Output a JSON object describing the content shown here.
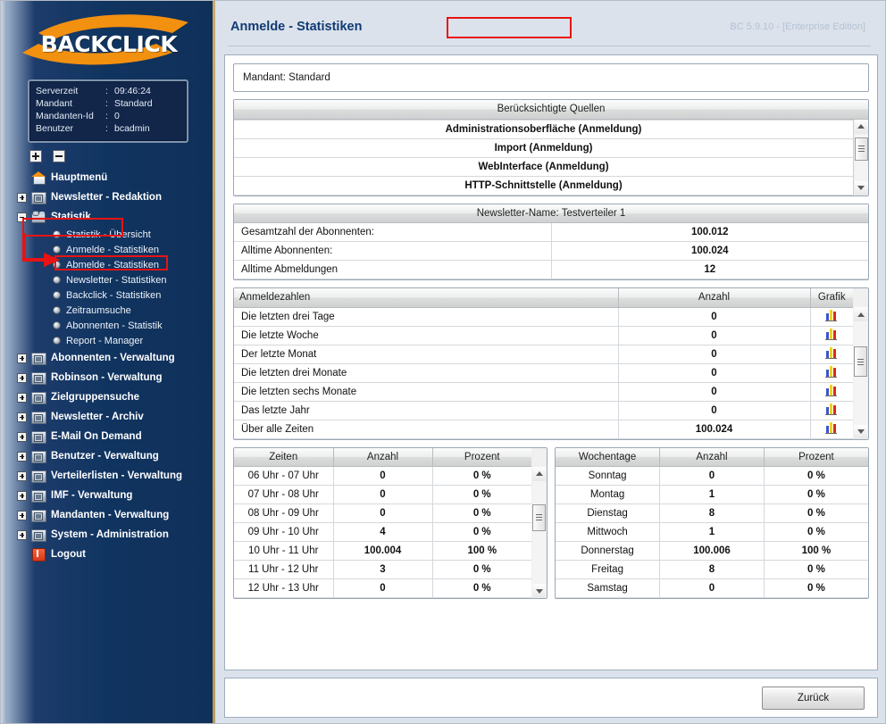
{
  "app": {
    "logo_text": "BACKCLICK",
    "version": "BC 5.9.10 - [Enterprise Edition]"
  },
  "sidebar": {
    "info": {
      "rows": [
        {
          "key": "Serverzeit",
          "sep": ":",
          "value": "09:46:24"
        },
        {
          "key": "Mandant",
          "sep": ":",
          "value": "Standard"
        },
        {
          "key": "Mandanten-Id",
          "sep": ":",
          "value": "0"
        },
        {
          "key": "Benutzer",
          "sep": ":",
          "value": "bcadmin"
        }
      ]
    },
    "expand_all_label": "+",
    "collapse_all_label": "-",
    "items": [
      {
        "label": "Hauptmenü",
        "icon": "house",
        "expander": "none"
      },
      {
        "label": "Newsletter - Redaktion",
        "icon": "folder",
        "expander": "plus"
      },
      {
        "label": "Statistik",
        "icon": "cam",
        "expander": "minus"
      },
      {
        "label": "Abonnenten - Verwaltung",
        "icon": "folder",
        "expander": "plus"
      },
      {
        "label": "Robinson - Verwaltung",
        "icon": "folder",
        "expander": "plus"
      },
      {
        "label": "Zielgruppensuche",
        "icon": "folder",
        "expander": "plus"
      },
      {
        "label": "Newsletter - Archiv",
        "icon": "folder",
        "expander": "plus"
      },
      {
        "label": "E-Mail On Demand",
        "icon": "folder",
        "expander": "plus"
      },
      {
        "label": "Benutzer - Verwaltung",
        "icon": "folder",
        "expander": "plus"
      },
      {
        "label": "Verteilerlisten - Verwaltung",
        "icon": "folder",
        "expander": "plus"
      },
      {
        "label": "IMF - Verwaltung",
        "icon": "folder",
        "expander": "plus"
      },
      {
        "label": "Mandanten - Verwaltung",
        "icon": "folder",
        "expander": "plus"
      },
      {
        "label": "System - Administration",
        "icon": "folder",
        "expander": "plus"
      },
      {
        "label": "Logout",
        "icon": "logout",
        "expander": "none"
      }
    ],
    "statistik_children": [
      "Statistik - Übersicht",
      "Anmelde - Statistiken",
      "Abmelde - Statistiken",
      "Newsletter - Statistiken",
      "Backclick - Statistiken",
      "Zeitraumsuche",
      "Abonnenten - Statistik",
      "Report - Manager"
    ]
  },
  "header": {
    "title": "Anmelde - Statistiken"
  },
  "main": {
    "mandant_line": "Mandant: Standard",
    "quellen": {
      "title": "Berücksichtigte Quellen",
      "items": [
        "Administrationsoberfläche (Anmeldung)",
        "Import (Anmeldung)",
        "WebInterface (Anmeldung)",
        "HTTP-Schnittstelle (Anmeldung)"
      ]
    },
    "newsletter": {
      "title": "Newsletter-Name:  Testverteiler 1",
      "rows": [
        {
          "label": "Gesamtzahl der Abonnenten:",
          "value": "100.012"
        },
        {
          "label": "Alltime Abonnenten:",
          "value": "100.024"
        },
        {
          "label": "Alltime Abmeldungen",
          "value": "12"
        }
      ]
    },
    "anmeldezahlen": {
      "headers": [
        "Anmeldezahlen",
        "Anzahl",
        "Grafik"
      ],
      "rows": [
        {
          "label": "Die letzten drei Tage",
          "value": "0",
          "grafik": "bar-chart-icon"
        },
        {
          "label": "Die letzte Woche",
          "value": "0",
          "grafik": "bar-chart-icon"
        },
        {
          "label": "Der letzte Monat",
          "value": "0",
          "grafik": "bar-chart-icon"
        },
        {
          "label": "Die letzten drei Monate",
          "value": "0",
          "grafik": "bar-chart-icon"
        },
        {
          "label": "Die letzten sechs Monate",
          "value": "0",
          "grafik": "bar-chart-icon"
        },
        {
          "label": "Das letzte Jahr",
          "value": "0",
          "grafik": "bar-chart-icon"
        },
        {
          "label": "Über alle Zeiten",
          "value": "100.024",
          "grafik": "bar-chart-icon"
        }
      ]
    },
    "zeiten": {
      "headers": [
        "Zeiten",
        "Anzahl",
        "Prozent"
      ],
      "rows": [
        {
          "label": "06 Uhr - 07 Uhr",
          "anzahl": "0",
          "prozent": "0 %"
        },
        {
          "label": "07 Uhr - 08 Uhr",
          "anzahl": "0",
          "prozent": "0 %"
        },
        {
          "label": "08 Uhr - 09 Uhr",
          "anzahl": "0",
          "prozent": "0 %"
        },
        {
          "label": "09 Uhr - 10 Uhr",
          "anzahl": "4",
          "prozent": "0 %"
        },
        {
          "label": "10 Uhr - 11 Uhr",
          "anzahl": "100.004",
          "prozent": "100 %"
        },
        {
          "label": "11 Uhr - 12 Uhr",
          "anzahl": "3",
          "prozent": "0 %"
        },
        {
          "label": "12 Uhr - 13 Uhr",
          "anzahl": "0",
          "prozent": "0 %"
        }
      ]
    },
    "wochentage": {
      "headers": [
        "Wochentage",
        "Anzahl",
        "Prozent"
      ],
      "rows": [
        {
          "label": "Sonntag",
          "anzahl": "0",
          "prozent": "0 %"
        },
        {
          "label": "Montag",
          "anzahl": "1",
          "prozent": "0 %"
        },
        {
          "label": "Dienstag",
          "anzahl": "8",
          "prozent": "0 %"
        },
        {
          "label": "Mittwoch",
          "anzahl": "1",
          "prozent": "0 %"
        },
        {
          "label": "Donnerstag",
          "anzahl": "100.006",
          "prozent": "100 %"
        },
        {
          "label": "Freitag",
          "anzahl": "8",
          "prozent": "0 %"
        },
        {
          "label": "Samstag",
          "anzahl": "0",
          "prozent": "0 %"
        }
      ]
    },
    "back_button": "Zurück"
  },
  "colors": {
    "accent_blue": "#103a73",
    "sidebar_dark": "#0f3059",
    "annotation_red": "#e81313",
    "logo_orange": "#f2900f"
  }
}
